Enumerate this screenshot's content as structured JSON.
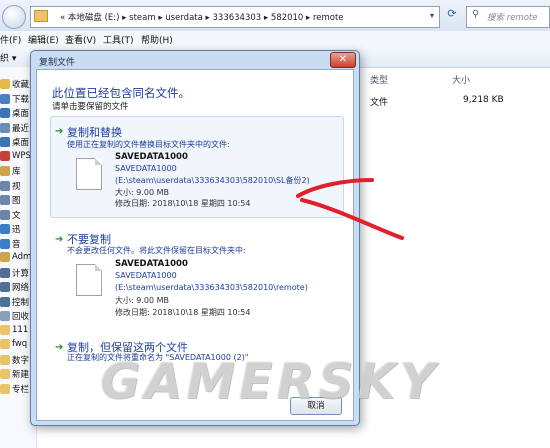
{
  "address": {
    "path": "« 本地磁盘 (E:) ▸ steam ▸ userdata ▸ 333634303 ▸ 582010 ▸ remote",
    "search_placeholder": "搜索 remote"
  },
  "menu": [
    "件(F)",
    "编辑(E)",
    "查看(V)",
    "工具(T)",
    "帮助(H)"
  ],
  "toolbar": {
    "organize": "织 ▾"
  },
  "nav_items": [
    {
      "label": "收藏夹",
      "color": "#e9b84a"
    },
    {
      "label": "下载",
      "color": "#4a7fc4"
    },
    {
      "label": "桌面",
      "color": "#3b73b8"
    },
    {
      "label": "最近",
      "color": "#6a8fb8"
    },
    {
      "label": "桌面",
      "color": "#3b73b8"
    },
    {
      "label": "WPS",
      "color": "#c7413a"
    },
    {
      "label": "库",
      "color": "#d0a347"
    },
    {
      "label": "视",
      "color": "#6b86a8"
    },
    {
      "label": "图",
      "color": "#6b86a8"
    },
    {
      "label": "文",
      "color": "#6b86a8"
    },
    {
      "label": "迅",
      "color": "#3a7ec7"
    },
    {
      "label": "音",
      "color": "#3a7ec7"
    },
    {
      "label": "Adm",
      "color": "#d0a347"
    },
    {
      "label": "计算",
      "color": "#4f6f96"
    },
    {
      "label": "网络",
      "color": "#4f6f96"
    },
    {
      "label": "控制",
      "color": "#4f6f96"
    },
    {
      "label": "回收",
      "color": "#8aa0b8"
    },
    {
      "label": "111",
      "color": "#e9c46a"
    },
    {
      "label": "fwq",
      "color": "#e9c46a"
    },
    {
      "label": "数字",
      "color": "#e9c46a"
    },
    {
      "label": "新建",
      "color": "#e9c46a"
    },
    {
      "label": "专栏",
      "color": "#e9c46a"
    }
  ],
  "columns": {
    "type": "类型",
    "size": "大小"
  },
  "file_row": {
    "type": "文件",
    "size": "9,218 KB"
  },
  "dialog": {
    "title": "复制文件",
    "heading": "此位置已经包含同名文件。",
    "subheading": "请单击要保留的文件",
    "replace": {
      "title": "复制和替换",
      "desc": "使用正在复制的文件替换目标文件夹中的文件:",
      "file_name": "SAVEDATA1000",
      "file_name2": "SAVEDATA1000",
      "path": "(E:\\steam\\userdata\\333634303\\582010\\SL备份2)",
      "size": "大小: 9.00 MB",
      "modified": "修改日期: 2018\\10\\18 星期四 10:54"
    },
    "dont_copy": {
      "title": "不要复制",
      "desc": "不会更改任何文件。将此文件保留在目标文件夹中:",
      "file_name": "SAVEDATA1000",
      "file_name2": "SAVEDATA1000",
      "path": "(E:\\steam\\userdata\\333634303\\582010\\remote)",
      "size": "大小: 9.00 MB",
      "modified": "修改日期: 2018\\10\\18 星期四 10:54"
    },
    "keep_both": {
      "title": "复制，但保留这两个文件",
      "desc": "正在复制的文件将重命名为 \"SAVEDATA1000 (2)\""
    },
    "cancel": "取消"
  },
  "watermark": "GAMERSKY",
  "colors": {
    "link_blue": "#1f3e9c",
    "annotation_red": "#e0202a",
    "option_hover_bg": "#f1f6fd"
  }
}
